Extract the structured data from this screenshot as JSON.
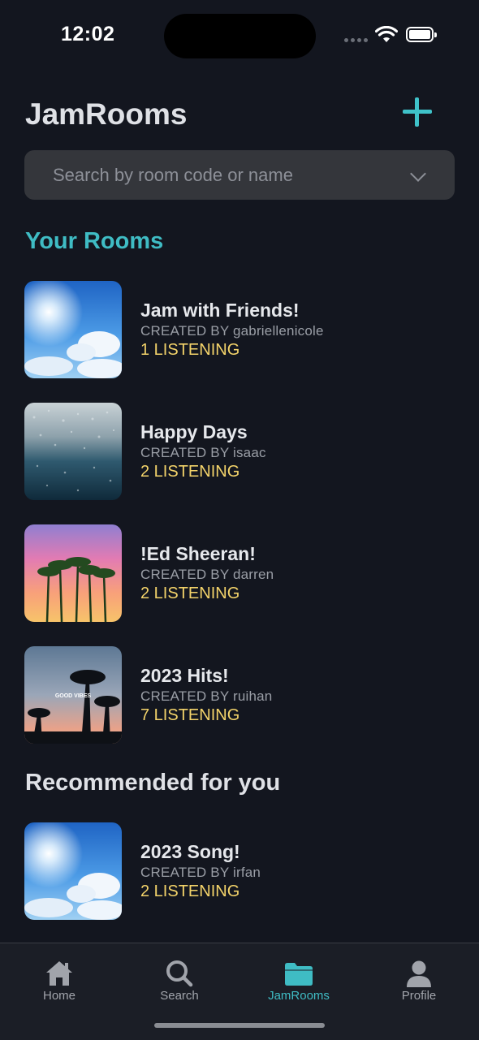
{
  "status": {
    "time": "12:02"
  },
  "header": {
    "title": "JamRooms",
    "add_icon": "plus-icon"
  },
  "search": {
    "placeholder": "Search by room code or name",
    "value": ""
  },
  "your_rooms": {
    "title": "Your Rooms",
    "items": [
      {
        "title": "Jam with Friends!",
        "creator": "CREATED BY gabriellenicole",
        "listening": "1 LISTENING",
        "thumb": "sunny-sky"
      },
      {
        "title": "Happy Days",
        "creator": "CREATED BY isaac",
        "listening": "2 LISTENING",
        "thumb": "rainy-window"
      },
      {
        "title": "!Ed Sheeran!",
        "creator": "CREATED BY darren",
        "listening": "2 LISTENING",
        "thumb": "palm-sunset"
      },
      {
        "title": "2023 Hits!",
        "creator": "CREATED BY ruihan",
        "listening": "7 LISTENING",
        "thumb": "good-vibes-palms",
        "thumb_text": "GOOD VIBES"
      }
    ]
  },
  "recommended": {
    "title": "Recommended for you",
    "items": [
      {
        "title": "2023 Song!",
        "creator": "CREATED BY irfan",
        "listening": "2 LISTENING",
        "thumb": "sunny-sky"
      }
    ]
  },
  "tabs": [
    {
      "label": "Home",
      "icon": "home-icon"
    },
    {
      "label": "Search",
      "icon": "search-icon"
    },
    {
      "label": "JamRooms",
      "icon": "folder-icon",
      "active": true
    },
    {
      "label": "Profile",
      "icon": "person-icon"
    }
  ],
  "colors": {
    "accent": "#3fbcc4",
    "listening": "#f3d36a",
    "background": "#13161f"
  }
}
